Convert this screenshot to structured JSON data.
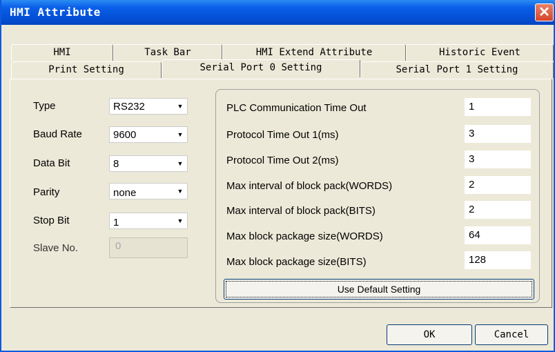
{
  "window": {
    "title": "HMI Attribute"
  },
  "tabs": {
    "row1": [
      "HMI",
      "Task Bar",
      "HMI Extend Attribute",
      "Historic Event"
    ],
    "row2": [
      "Print Setting",
      "Serial Port 0 Setting",
      "Serial Port 1 Setting"
    ],
    "active": "Serial Port 0 Setting"
  },
  "left": {
    "type": {
      "label": "Type",
      "value": "RS232"
    },
    "baud": {
      "label": "Baud Rate",
      "value": "9600"
    },
    "databit": {
      "label": "Data Bit",
      "value": "8"
    },
    "parity": {
      "label": "Parity",
      "value": "none"
    },
    "stopbit": {
      "label": "Stop Bit",
      "value": "1"
    },
    "slave": {
      "label": "Slave No.",
      "value": "0"
    }
  },
  "right": {
    "fields": [
      {
        "label": "PLC Communication Time Out",
        "value": "1"
      },
      {
        "label": "Protocol Time Out 1(ms)",
        "value": "3"
      },
      {
        "label": "Protocol Time Out 2(ms)",
        "value": "3"
      },
      {
        "label": "Max interval of block pack(WORDS)",
        "value": "2"
      },
      {
        "label": "Max interval of block pack(BITS)",
        "value": "2"
      },
      {
        "label": "Max block package size(WORDS)",
        "value": "64"
      },
      {
        "label": "Max block package size(BITS)",
        "value": "128"
      }
    ],
    "default_button": "Use Default Setting"
  },
  "footer": {
    "ok": "OK",
    "cancel": "Cancel"
  },
  "icons": {
    "close": "close-icon",
    "dropdown": "chevron-down-icon"
  }
}
